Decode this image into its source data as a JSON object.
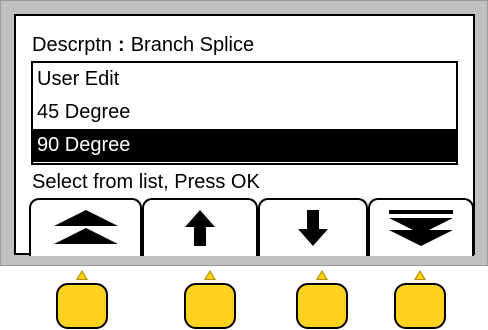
{
  "header": {
    "label": "Descrptn",
    "separator": ":",
    "value": "Branch Splice"
  },
  "list": {
    "items": [
      {
        "label": "User Edit",
        "selected": false
      },
      {
        "label": "45 Degree",
        "selected": false
      },
      {
        "label": "90 Degree",
        "selected": true
      }
    ]
  },
  "prompt": "Select from list,  Press OK",
  "softkeys": [
    {
      "name": "page-up",
      "icon": "double-up-arrow-icon"
    },
    {
      "name": "up",
      "icon": "up-arrow-icon"
    },
    {
      "name": "down",
      "icon": "down-arrow-icon"
    },
    {
      "name": "page-down",
      "icon": "double-down-arrow-icon"
    }
  ],
  "colors": {
    "bezel": "#c0c0c0",
    "button": "#ffd21f",
    "selection": "#000000"
  }
}
